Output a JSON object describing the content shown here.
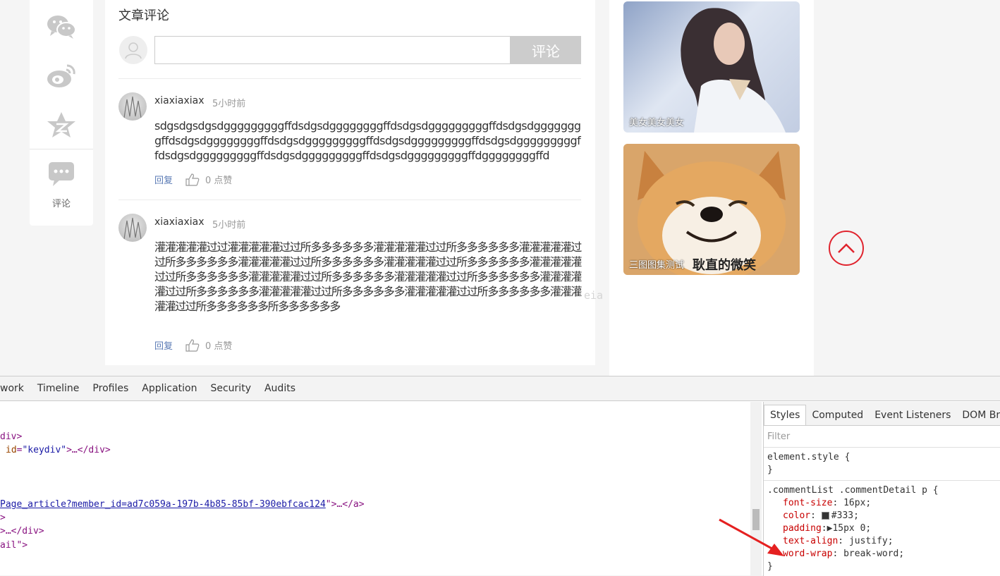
{
  "share": {
    "comment_label": "评论",
    "icons": [
      "wechat-icon",
      "weibo-icon",
      "qzone-icon",
      "comment-icon"
    ]
  },
  "comments_section": {
    "title": "文章评论",
    "input_placeholder": "",
    "submit_label": "评论"
  },
  "comments": [
    {
      "user": "xiaxiaxiax",
      "time": "5小时前",
      "text": "sdgsdgsdgsdgggggggggffdsdgsdggggggggffdsdgsdgggggggggffdsdgsdggggggggffdsdgsdggggggggffdsdgsdgggggggggffdsdgsdgggggggggffdsdgsdgggggggggffdsdgsdgggggggggffdsdgsdgggggggggffdsdgsdgggggggggffdggggggggffd",
      "reply": "回复",
      "likes": "0 点赞"
    },
    {
      "user": "xiaxiaxiax",
      "time": "5小时前",
      "text": "灌灌灌灌灌过过灌灌灌灌灌过过所多多多多多多灌灌灌灌灌过过所多多多多多多灌灌灌灌灌过过所多多多多多多灌灌灌灌灌过过所多多多多多多灌灌灌灌灌过过所多多多多多多灌灌灌灌灌过过所多多多多多多灌灌灌灌灌过过所多多多多多多灌灌灌灌灌过过所多多多多多多灌灌灌灌灌过过所多多多多多多灌灌灌灌灌过过所多多多多多多灌灌灌灌灌过过所多多多多多多灌灌灌灌灌过过所多多多多多多所多多多多多多",
      "reply": "回复",
      "likes": "0 点赞"
    }
  ],
  "sidebar_pics": [
    {
      "caption": "美女美女美女"
    },
    {
      "caption": "三图图集测试",
      "overlay_text": "耿直的微笑"
    }
  ],
  "watermark": "eia",
  "devtools": {
    "tabs": [
      "work",
      "Timeline",
      "Profiles",
      "Application",
      "Security",
      "Audits"
    ],
    "elements": {
      "line1": "div>",
      "line2_attr": "id",
      "line2_val": "\"keydiv\"",
      "line2_rest": ">…</div>",
      "line5_link": "Page_article?member_id=ad7c059a-197b-4b85-85bf-390ebfcac124",
      "line5_rest": "\">…</a>",
      "line6": ">",
      "line7": ">…</div>",
      "line8": "ail\">"
    },
    "styles_tabs": [
      "Styles",
      "Computed",
      "Event Listeners",
      "DOM Breakp"
    ],
    "filter_placeholder": "Filter",
    "element_style": "element.style {",
    "element_style_close": "}",
    "rule_selector": ".commentList .commentDetail p {",
    "rule_props": [
      {
        "name": "font-size",
        "value": "16px;"
      },
      {
        "name": "color",
        "value": "#333;"
      },
      {
        "name": "padding",
        "value": "15px 0;"
      },
      {
        "name": "text-align",
        "value": "justify;"
      },
      {
        "name": "word-wrap",
        "value": "break-word;"
      }
    ],
    "rule_close": "}"
  },
  "colors": {
    "accent_red": "#e0242e",
    "link_blue": "#5b7bb5",
    "button_gray": "#cccccc"
  }
}
